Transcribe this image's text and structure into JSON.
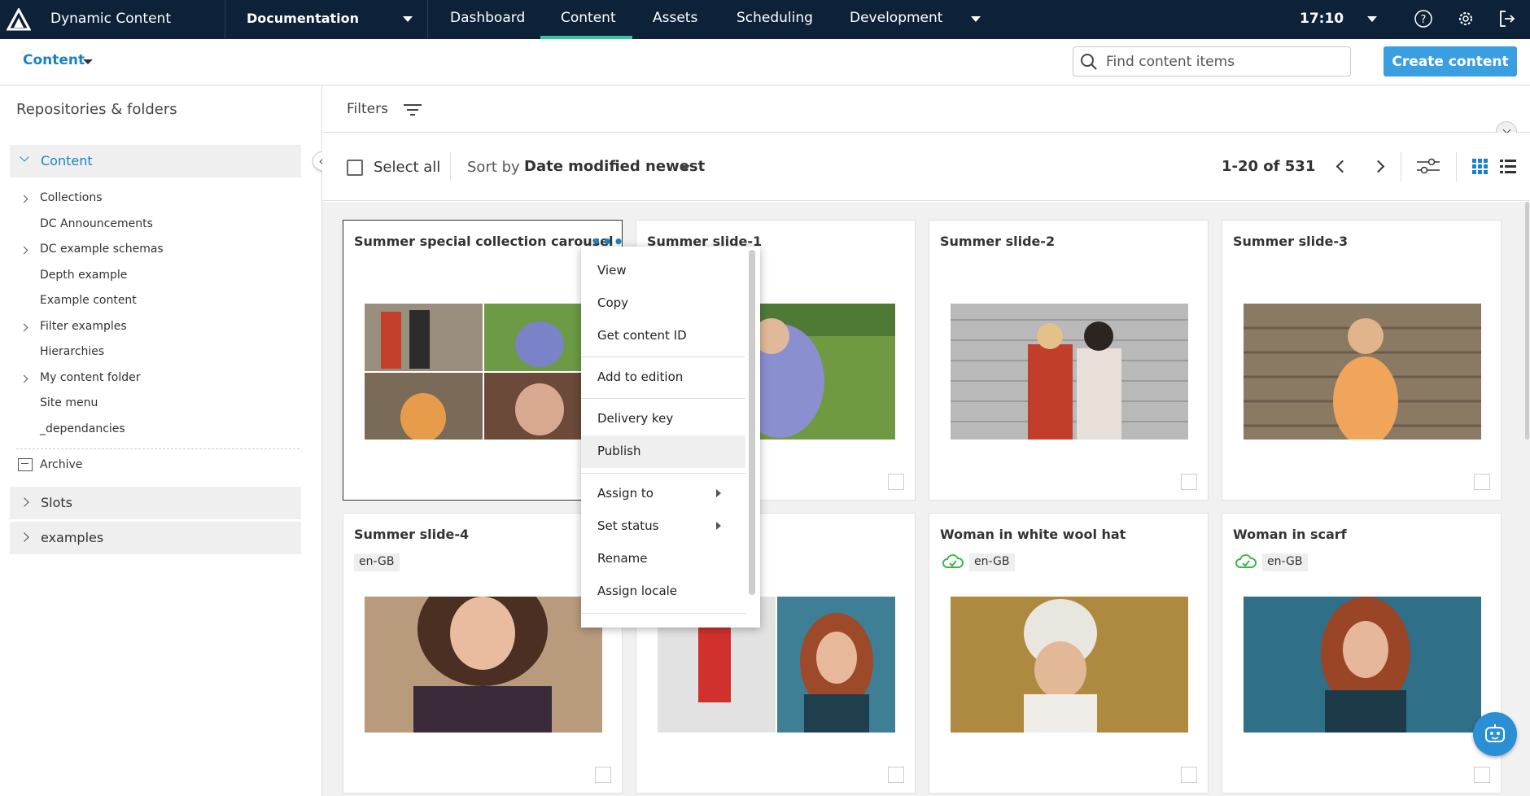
{
  "app": {
    "name": "Dynamic Content"
  },
  "topbar": {
    "hub": "Documentation",
    "tabs": [
      "Dashboard",
      "Content",
      "Assets",
      "Scheduling",
      "Development"
    ],
    "active_tab": "Content",
    "time": "17:10"
  },
  "subheader": {
    "content_menu": "Content",
    "search_placeholder": "Find content items",
    "create_label": "Create content"
  },
  "sidebar": {
    "title": "Repositories & folders",
    "repo_content": "Content",
    "folders": [
      "Collections",
      "DC Announcements",
      "DC example schemas",
      "Depth example",
      "Example content",
      "Filter examples",
      "Hierarchies",
      "My content folder",
      "Site menu",
      "_dependancies"
    ],
    "archive": "Archive",
    "repo_slots": "Slots",
    "repo_examples": "examples"
  },
  "toolbar": {
    "filters": "Filters",
    "select_all": "Select all",
    "sort_by": "Sort by",
    "sort_value": "Date modified newest",
    "pagination": "1-20 of 531"
  },
  "cards": [
    {
      "title": "Summer special collection carousel"
    },
    {
      "title": "Summer slide-1"
    },
    {
      "title": "Summer slide-2"
    },
    {
      "title": "Summer slide-3"
    },
    {
      "title": "Summer slide-4",
      "locale": "en-GB"
    },
    {
      "title": ""
    },
    {
      "title": "Woman in white wool hat",
      "locale": "en-GB"
    },
    {
      "title": "Woman in scarf",
      "locale": "en-GB"
    }
  ],
  "context_menu": [
    "View",
    "Copy",
    "Get content ID",
    "Add to edition",
    "Delivery key",
    "Publish",
    "Assign to",
    "Set status",
    "Rename",
    "Assign locale"
  ],
  "colors": {
    "topbar": "#0d2238",
    "accent": "#1a82c4",
    "active_tab": "#39c3a3",
    "button": "#3a9fe0",
    "published": "#3bb54a"
  }
}
